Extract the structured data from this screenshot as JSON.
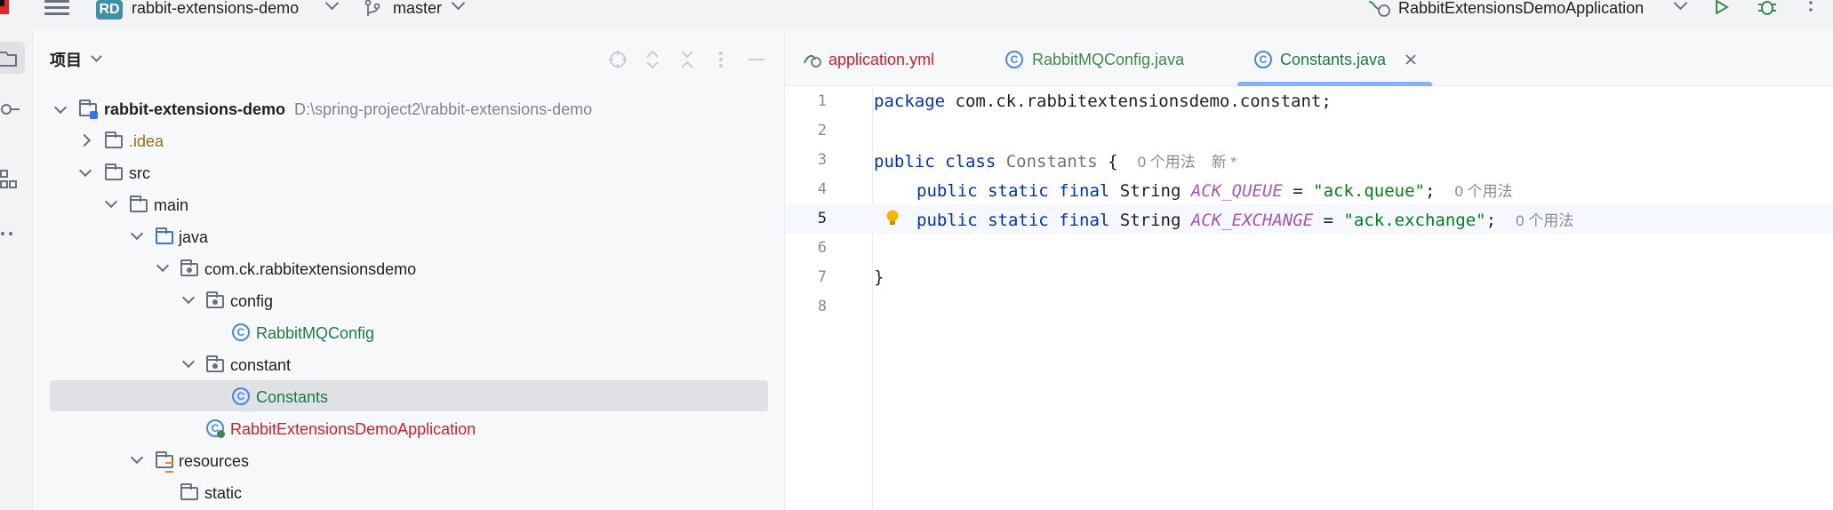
{
  "titlebar": {
    "project_badge": "RD",
    "project_name": "rabbit-extensions-demo",
    "branch": "master",
    "run_config": "RabbitExtensionsDemoApplication"
  },
  "project_panel": {
    "title": "项目",
    "tree": [
      {
        "label": "rabbit-extensions-demo",
        "path": "D:\\spring-project2\\rabbit-extensions-demo",
        "type": "module",
        "expanded": true
      },
      {
        "label": ".idea",
        "type": "folder",
        "expanded": false
      },
      {
        "label": "src",
        "type": "folder",
        "expanded": true
      },
      {
        "label": "main",
        "type": "folder",
        "expanded": true
      },
      {
        "label": "java",
        "type": "source-folder",
        "expanded": true
      },
      {
        "label": "com.ck.rabbitextensionsdemo",
        "type": "package",
        "expanded": true
      },
      {
        "label": "config",
        "type": "package",
        "expanded": true
      },
      {
        "label": "RabbitMQConfig",
        "type": "class"
      },
      {
        "label": "constant",
        "type": "package",
        "expanded": true
      },
      {
        "label": "Constants",
        "type": "class",
        "selected": true
      },
      {
        "label": "RabbitExtensionsDemoApplication",
        "type": "spring-app"
      },
      {
        "label": "resources",
        "type": "resources-folder",
        "expanded": true
      },
      {
        "label": "static",
        "type": "folder"
      }
    ]
  },
  "editor": {
    "tabs": [
      {
        "label": "application.yml",
        "color": "#c7222d",
        "active": false
      },
      {
        "label": "RabbitMQConfig.java",
        "color": "#3b8a4a",
        "active": false
      },
      {
        "label": "Constants.java",
        "color": "#1e7a45",
        "active": true
      }
    ],
    "line_numbers": [
      "1",
      "2",
      "3",
      "4",
      "5",
      "6",
      "7",
      "8"
    ],
    "code": {
      "l1_kw": "package",
      "l1_rest": " com.ck.rabbitextensionsdemo.constant;",
      "l3_kw": "public class",
      "l3_name": " Constants",
      "l3_brace": " {",
      "l3_hint1": "0 个用法",
      "l3_hint2": "新 *",
      "l4_kw": "public static final",
      "l4_type": " String ",
      "l4_const": "ACK_QUEUE",
      "l4_eq": " = ",
      "l4_str": "\"ack.queue\"",
      "l4_semi": ";",
      "l4_hint": "0 个用法",
      "l5_kw": "public static final",
      "l5_type": " String ",
      "l5_const": "ACK_EXCHANGE",
      "l5_eq": " = ",
      "l5_str": "\"ack.exchange\"",
      "l5_semi": ";",
      "l5_hint": "0 个用法",
      "l7_brace": "}"
    }
  },
  "icons": [
    "hamburger-icon",
    "branch-icon",
    "run-icon",
    "debug-icon",
    "more-icon",
    "project-icon",
    "commit-icon",
    "structure-icon",
    "locate-icon",
    "expand-icon",
    "collapse-icon",
    "options-icon",
    "hide-icon",
    "bulb-icon"
  ]
}
